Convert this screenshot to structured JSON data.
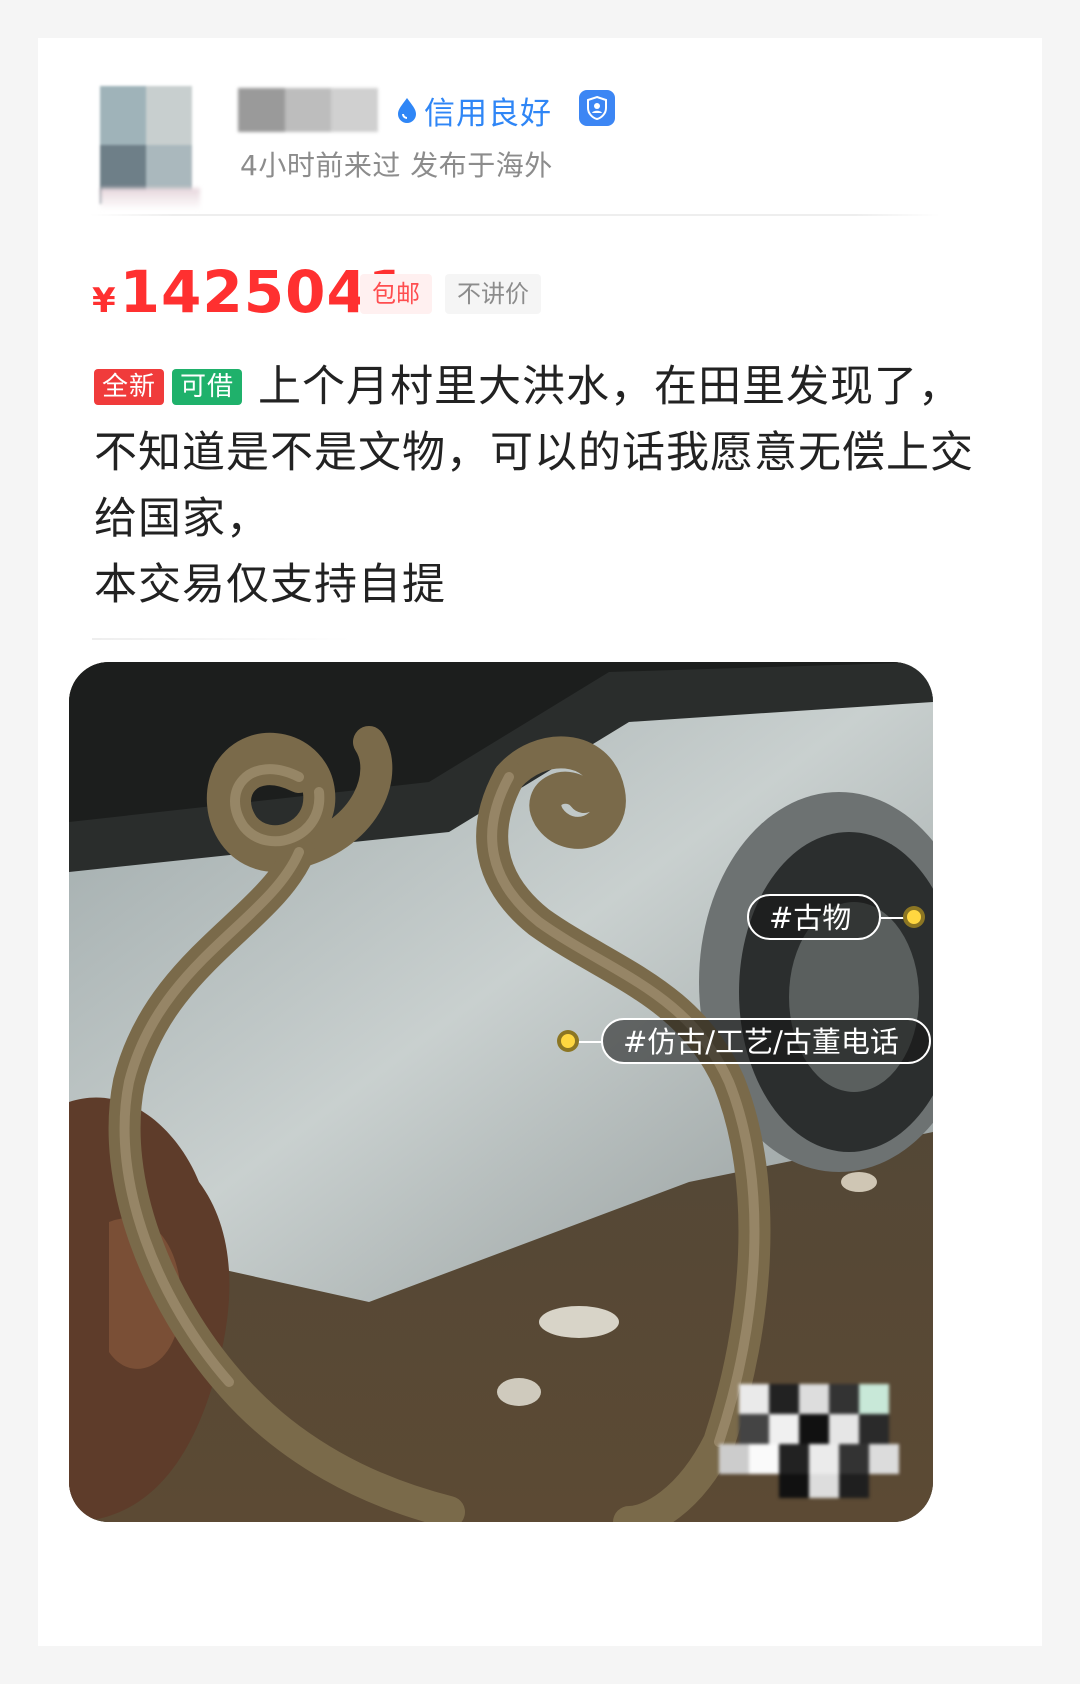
{
  "seller": {
    "credit_label": "信用良好",
    "activity": "4小时前来过 发布于海外"
  },
  "listing": {
    "currency": "¥",
    "price": "1425041",
    "tags": {
      "shipping": "包邮",
      "no_bargain": "不讲价"
    },
    "badges": {
      "condition": "全新",
      "lend": "可借"
    },
    "description": [
      "上个月村里大洪水，在田里发现了，不知道是不是文物，可以的话我愿意无偿上交给国家，",
      "本交易仅支持自提"
    ]
  },
  "photo": {
    "labels": {
      "antique": "#古物",
      "imitation": "#仿古/工艺/古董电话"
    }
  },
  "colors": {
    "price_red": "#ff3030",
    "credit_blue": "#2f86f6",
    "new_badge": "#f03b3b",
    "lend_badge": "#1fb16b",
    "label_dot": "#ffd740"
  },
  "icons": [
    "water-drop-icon",
    "shield-user-icon"
  ]
}
